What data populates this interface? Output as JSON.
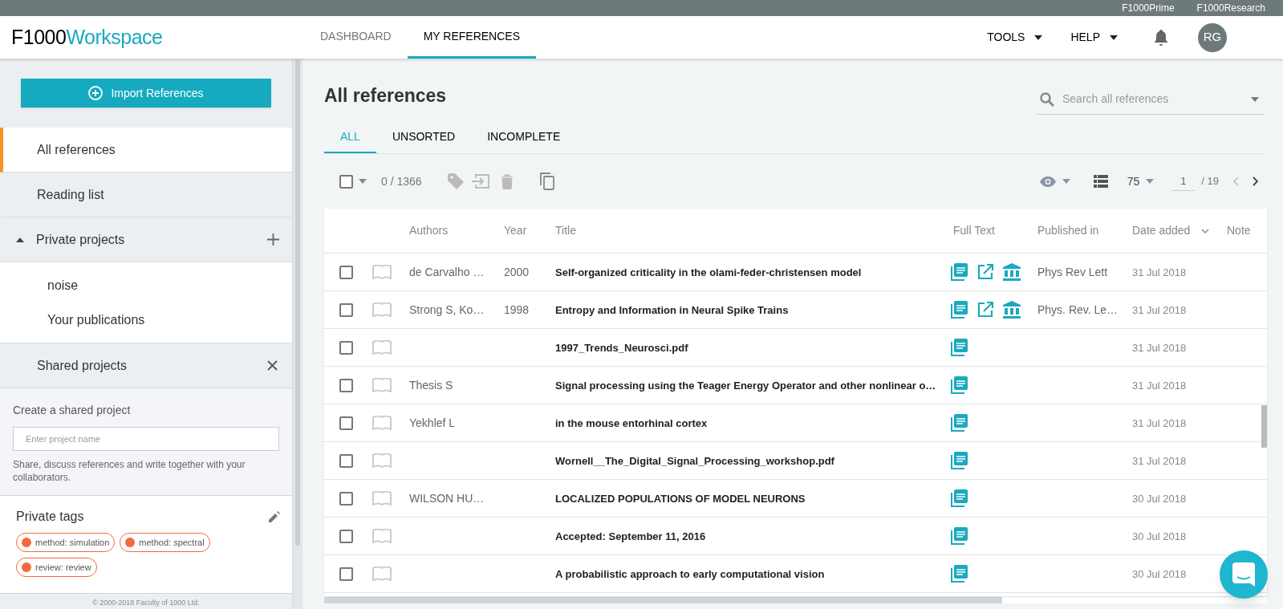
{
  "top_links": [
    "F1000Prime",
    "F1000Research"
  ],
  "logo": {
    "dark": "F1000",
    "light": "Workspace"
  },
  "nav": [
    {
      "label": "DASHBOARD",
      "selected": false
    },
    {
      "label": "MY REFERENCES",
      "selected": true
    }
  ],
  "menus": [
    "TOOLS",
    "HELP"
  ],
  "avatar": "RG",
  "sidebar": {
    "import_button": "Import References",
    "items": [
      {
        "label": "All references",
        "selected": true
      },
      {
        "label": "Reading list",
        "selected": false
      }
    ],
    "private_projects": {
      "label": "Private projects",
      "expanded": true,
      "children": [
        "noise",
        "Your publications"
      ]
    },
    "shared_projects": {
      "label": "Shared projects",
      "expanded": true,
      "heading": "Create a shared project",
      "placeholder": "Enter project name",
      "note": "Share, discuss references and write together with your collaborators."
    },
    "private_tags": {
      "label": "Private tags",
      "tags": [
        "method: simulation",
        "method: spectral",
        "review: review"
      ]
    },
    "footer": "© 2000-2018 Faculty of 1000 Ltd."
  },
  "main": {
    "title": "All references",
    "search": {
      "placeholder": "Search all references"
    },
    "tabs": [
      {
        "label": "ALL",
        "selected": true
      },
      {
        "label": "UNSORTED",
        "selected": false
      },
      {
        "label": "INCOMPLETE",
        "selected": false
      }
    ],
    "toolbar": {
      "selection_count": "0 / 1366",
      "select_all_checked": false,
      "per_page": "75",
      "page": "1",
      "page_total": "/ 19"
    },
    "table": {
      "columns": [
        {
          "label": "Authors",
          "sorted": false
        },
        {
          "label": "Year",
          "sorted": false
        },
        {
          "label": "Title",
          "sorted": false
        },
        {
          "label": "Full Text",
          "sorted": false
        },
        {
          "label": "Published in",
          "sorted": false
        },
        {
          "label": "Date added",
          "sorted": true
        },
        {
          "label": "Note",
          "sorted": false
        }
      ],
      "rows": [
        {
          "checked": false,
          "reading_list": false,
          "authors": "de Carvalho …",
          "year": "2000",
          "title": "Self-organized criticality in the olami-feder-christensen model",
          "full_text": [
            {
              "kind": "pdf"
            },
            {
              "kind": "link"
            },
            {
              "kind": "library"
            }
          ],
          "published_in": "Phys Rev Lett",
          "date_added": "31 Jul 2018"
        },
        {
          "checked": false,
          "reading_list": false,
          "authors": "Strong S, Ko…",
          "year": "1998",
          "title": "Entropy and Information in Neural Spike Trains",
          "full_text": [
            {
              "kind": "pdf"
            },
            {
              "kind": "link"
            },
            {
              "kind": "library"
            }
          ],
          "published_in": "Phys. Rev. Le…",
          "date_added": "31 Jul 2018"
        },
        {
          "checked": false,
          "reading_list": false,
          "title": "1997_Trends_Neurosci.pdf",
          "full_text": [
            {
              "kind": "pdf"
            }
          ],
          "date_added": "31 Jul 2018"
        },
        {
          "checked": false,
          "reading_list": false,
          "authors": "Thesis S",
          "title": "Signal processing using the Teager Energy Operator and other nonlinear o…",
          "full_text": [
            {
              "kind": "pdf"
            }
          ],
          "date_added": "31 Jul 2018"
        },
        {
          "checked": false,
          "reading_list": false,
          "authors": "Yekhlef L",
          "title": "in the mouse entorhinal cortex",
          "full_text": [
            {
              "kind": "pdf"
            }
          ],
          "date_added": "31 Jul 2018"
        },
        {
          "checked": false,
          "reading_list": false,
          "title": "Wornell__The_Digital_Signal_Processing_workshop.pdf",
          "full_text": [
            {
              "kind": "pdf"
            }
          ],
          "date_added": "31 Jul 2018"
        },
        {
          "checked": false,
          "reading_list": false,
          "authors": "WILSON HU…",
          "title": "LOCALIZED POPULATIONS OF MODEL NEURONS",
          "full_text": [
            {
              "kind": "pdf"
            }
          ],
          "date_added": "30 Jul 2018"
        },
        {
          "checked": false,
          "reading_list": false,
          "title": "Accepted: September 11, 2016",
          "full_text": [
            {
              "kind": "pdf"
            }
          ],
          "date_added": "30 Jul 2018"
        },
        {
          "checked": false,
          "reading_list": false,
          "title": "A probabilistic approach to early computational vision",
          "full_text": [
            {
              "kind": "pdf"
            }
          ],
          "date_added": "30 Jul 2018"
        }
      ]
    }
  }
}
